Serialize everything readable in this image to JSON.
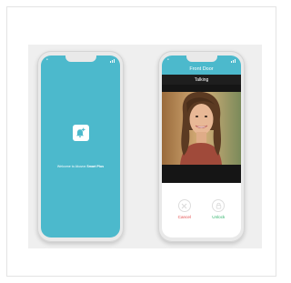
{
  "left_phone": {
    "welcome_prefix": "Welcome to Akuvox ",
    "welcome_brand": "Smart Plus",
    "icon": "bell-plus-icon"
  },
  "right_phone": {
    "header_title": "Front Door",
    "call_status": "Talking",
    "actions": [
      {
        "label": "Cancel",
        "icon": "close-icon",
        "color": "#e34a4a"
      },
      {
        "label": "Unlock",
        "icon": "lock-icon",
        "color": "#2fb36a"
      }
    ]
  },
  "colors": {
    "accent": "#4cb9cc",
    "status_bar": "#1e1e1e"
  }
}
